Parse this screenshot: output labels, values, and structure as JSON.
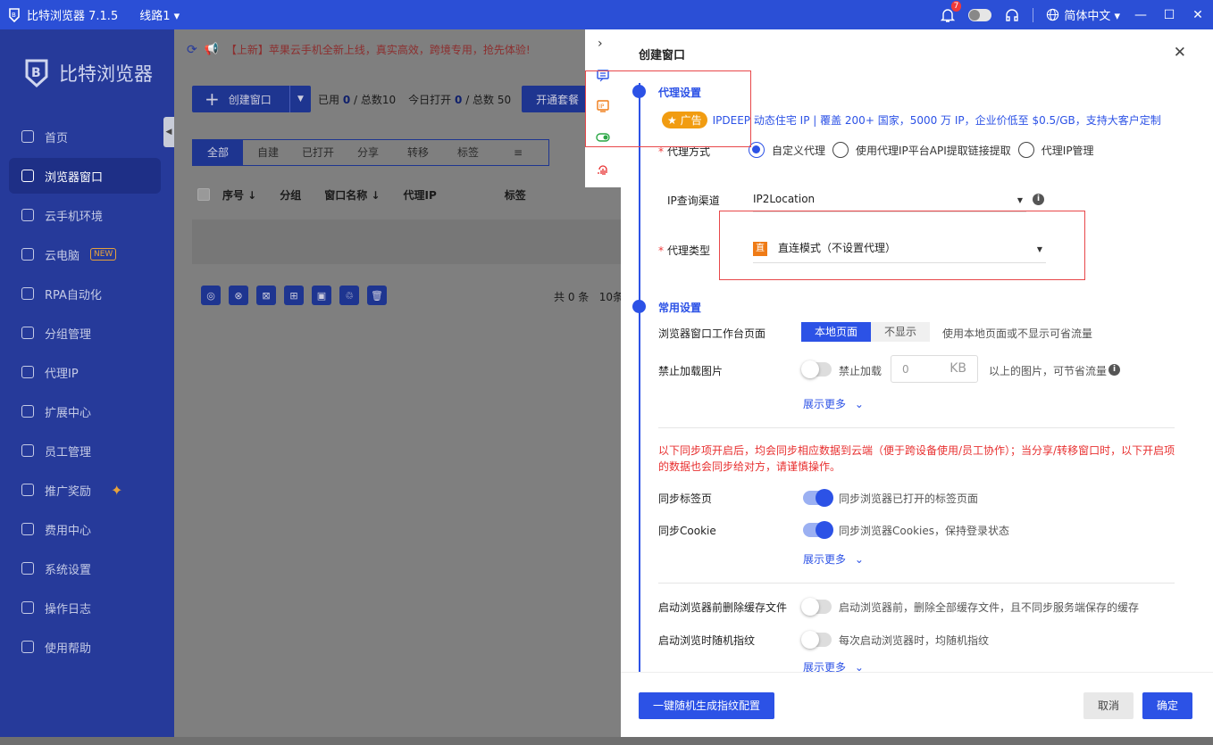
{
  "titlebar": {
    "app_title": "比特浏览器 7.1.5",
    "route": "线路1 ▾",
    "notification_count": "7",
    "language": "简体中文 ▾"
  },
  "sidebar": {
    "brand": "比特浏览器",
    "items": [
      {
        "label": "首页",
        "icon": "home-icon"
      },
      {
        "label": "浏览器窗口",
        "icon": "grid-icon",
        "active": true
      },
      {
        "label": "云手机环境",
        "icon": "cloud-icon"
      },
      {
        "label": "云电脑",
        "icon": "monitor-icon",
        "badge": "NEW"
      },
      {
        "label": "RPA自动化",
        "icon": "robot-icon"
      },
      {
        "label": "分组管理",
        "icon": "layers-icon"
      },
      {
        "label": "代理IP",
        "icon": "location-icon"
      },
      {
        "label": "扩展中心",
        "icon": "puzzle-icon"
      },
      {
        "label": "员工管理",
        "icon": "users-icon"
      },
      {
        "label": "推广奖励",
        "icon": "gift-icon"
      },
      {
        "label": "费用中心",
        "icon": "wallet-icon"
      },
      {
        "label": "系统设置",
        "icon": "gear-icon"
      },
      {
        "label": "操作日志",
        "icon": "log-icon"
      },
      {
        "label": "使用帮助",
        "icon": "help-icon"
      }
    ]
  },
  "main": {
    "announcement": "【上新】苹果云手机全新上线，真实高效，跨境专用，抢先体验!",
    "create_button": "创建窗口",
    "stat_used_label": "已用",
    "stat_used": "0",
    "stat_total_label": "/ 总数",
    "stat_total": "10",
    "stat_today_label": "今日打开",
    "stat_today": "0",
    "stat_today_total_label": "/ 总数",
    "stat_today_total": "50",
    "plan_button": "开通套餐",
    "filter_tabs": [
      "全部",
      "自建",
      "已打开",
      "分享",
      "转移",
      "标签"
    ],
    "columns": [
      "序号 ↓",
      "分组",
      "窗口名称 ↓",
      "代理IP",
      "标签"
    ],
    "total_text": "共 0 条",
    "page_size": "10条"
  },
  "dialog": {
    "title": "创建窗口",
    "proxy_section": "代理设置",
    "ad_badge": "广告",
    "ad_text": "IPDEEP 动态住宅 IP | 覆盖 200+ 国家，5000 万 IP，企业价低至 $0.5/GB，支持大客户定制",
    "proxy_method_label": "代理方式",
    "proxy_methods": [
      "自定义代理",
      "使用代理IP平台API提取链接提取",
      "代理IP管理"
    ],
    "ip_channel_label": "IP查询渠道",
    "ip_channel_value": "IP2Location",
    "proxy_type_label": "代理类型",
    "proxy_type_badge": "直",
    "proxy_type_value": "直连模式（不设置代理）",
    "common_section": "常用设置",
    "workbench_label": "浏览器窗口工作台页面",
    "workbench_options": [
      "本地页面",
      "不显示"
    ],
    "workbench_desc": "使用本地页面或不显示可省流量",
    "block_images_label": "禁止加载图片",
    "block_images_switch": "禁止加载",
    "block_images_value": "0",
    "block_images_unit": "KB",
    "block_images_desc": "以上的图片，可节省流量",
    "show_more": "展示更多",
    "warning": "以下同步项开启后，均会同步相应数据到云端（便于跨设备使用/员工协作）；当分享/转移窗口时，以下开启项的数据也会同步给对方，请谨慎操作。",
    "sync_tabs_label": "同步标签页",
    "sync_tabs_desc": "同步浏览器已打开的标签页面",
    "sync_cookie_label": "同步Cookie",
    "sync_cookie_desc": "同步浏览器Cookies，保持登录状态",
    "clear_cache_label": "启动浏览器前删除缓存文件",
    "clear_cache_desc": "启动浏览器前，删除全部缓存文件，且不同步服务端保存的缓存",
    "random_fp_label": "启动浏览时随机指纹",
    "random_fp_desc": "每次启动浏览器时，均随机指纹",
    "gen_button": "一键随机生成指纹配置",
    "cancel_button": "取消",
    "confirm_button": "确定"
  },
  "colors": {
    "primary": "#2c52e6",
    "sidebar": "#263a9a",
    "titlebar": "#2b4fd6",
    "danger": "#e83030",
    "ad": "#f19c11"
  }
}
